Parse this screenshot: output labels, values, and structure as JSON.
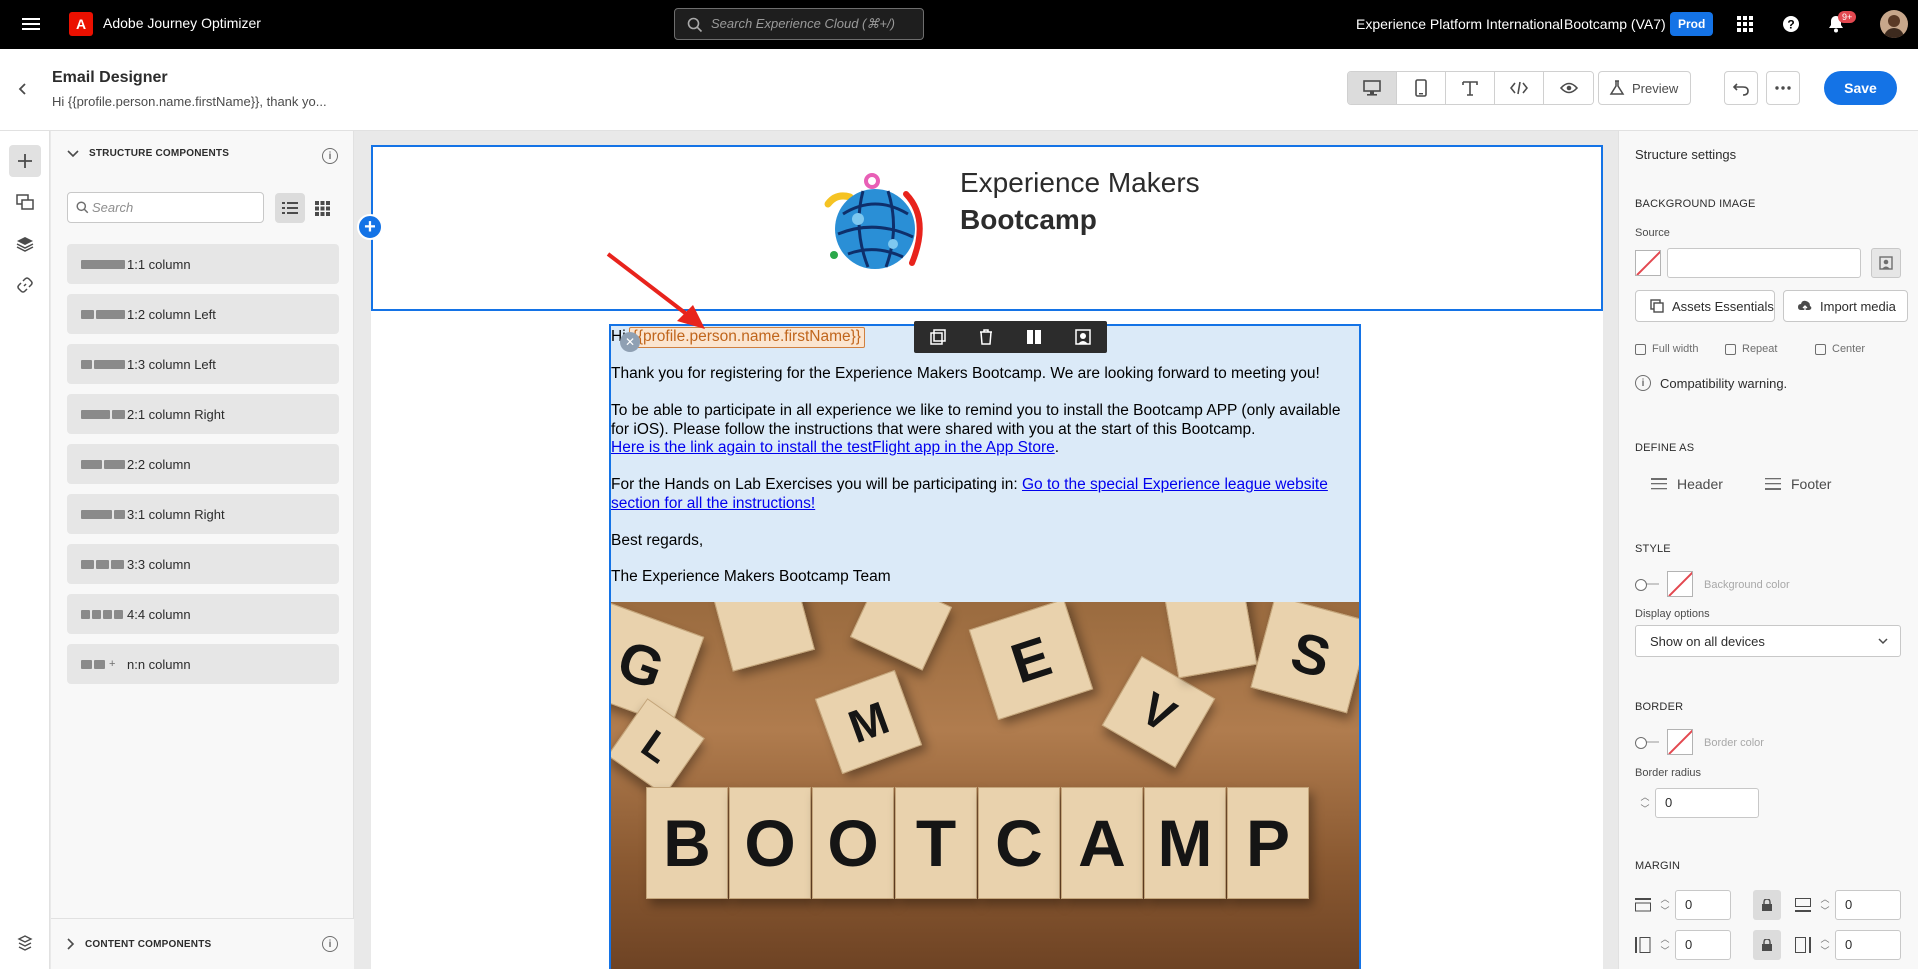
{
  "topbar": {
    "app_name": "Adobe Journey Optimizer",
    "search_placeholder": "Search Experience Cloud (⌘+/)",
    "org": "Experience Platform International",
    "sandbox": "Bootcamp (VA7)",
    "env_badge": "Prod",
    "notifications_count": "9+"
  },
  "header": {
    "title": "Email Designer",
    "subtitle": "Hi {{profile.person.name.firstName}}, thank yo...",
    "preview_label": "Preview",
    "save_label": "Save"
  },
  "left_panel": {
    "structure_heading": "STRUCTURE COMPONENTS",
    "search_placeholder": "Search",
    "components": [
      {
        "label": "1:1 column"
      },
      {
        "label": "1:2 column Left"
      },
      {
        "label": "1:3 column Left"
      },
      {
        "label": "2:1 column Right"
      },
      {
        "label": "2:2 column"
      },
      {
        "label": "3:1 column Right"
      },
      {
        "label": "3:3 column"
      },
      {
        "label": "4:4 column"
      },
      {
        "label": "n:n column"
      }
    ],
    "content_heading": "CONTENT COMPONENTS"
  },
  "email": {
    "logo_line1": "Experience Makers",
    "logo_line2": "Bootcamp",
    "greeting": "Hi",
    "token": "{{profile.person.name.firstName}}",
    "para1": "Thank you for registering for the Experience Makers Bootcamp. We are looking forward to meeting you!",
    "para2": "To be able to participate in all experience we like to remind you to install the Bootcamp APP (only available for iOS). Please follow the instructions that were shared with you at the start of this Bootcamp.",
    "link1": "Here is the link again to install the testFlight app in the App Store",
    "link1_suffix": ".",
    "para3": "For the Hands on Lab Exercises you will be participating in:",
    "link2": "Go to the special Experience league website section for all the instructions!",
    "signoff": "Best regards,",
    "signature": "The Experience Makers Bootcamp Team",
    "image_letters": [
      "B",
      "O",
      "O",
      "T",
      "C",
      "A",
      "M",
      "P"
    ]
  },
  "right_panel": {
    "title": "Structure settings",
    "bg_image_heading": "BACKGROUND IMAGE",
    "source_label": "Source",
    "source_value": "",
    "assets_button": "Assets Essentials",
    "import_button": "Import media",
    "full_width": "Full width",
    "repeat": "Repeat",
    "center": "Center",
    "compat_warning": "Compatibility warning.",
    "define_as_heading": "DEFINE AS",
    "header_option": "Header",
    "footer_option": "Footer",
    "style_heading": "STYLE",
    "bg_color_label": "Background color",
    "display_options_label": "Display options",
    "display_options_value": "Show on all devices",
    "border_heading": "BORDER",
    "border_color_label": "Border color",
    "border_radius_label": "Border radius",
    "border_radius_value": "0",
    "margin_heading": "MARGIN",
    "margin_top": "0",
    "margin_bottom": "0",
    "margin_left": "0",
    "margin_right": "0"
  },
  "colors": {
    "accent": "#1473e6",
    "topbar": "#000000",
    "selection_fill": "#dbeaf8",
    "annotation_arrow": "#e8231c",
    "token": "#c0651c"
  }
}
